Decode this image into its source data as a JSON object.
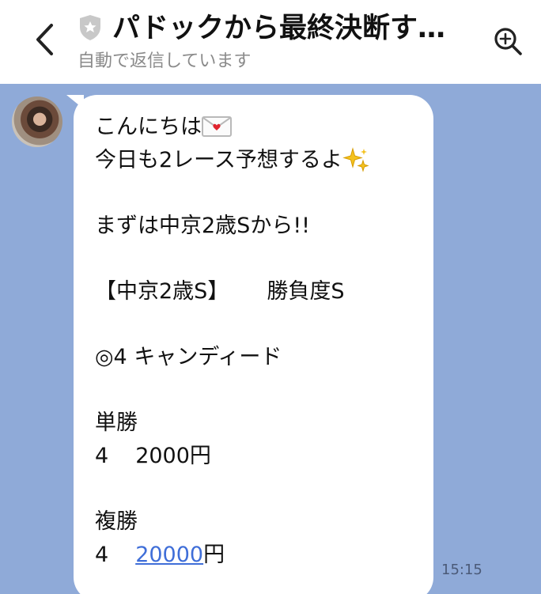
{
  "header": {
    "back_icon": "chevron-left-icon",
    "verified_icon": "shield-star-icon",
    "title": "パドックから最終決断す…",
    "subtitle": "自動で返信しています",
    "search_icon": "search-icon"
  },
  "message": {
    "line1": "こんにちは",
    "line1_emoji": "envelope-heart-emoji",
    "line2": "今日も2レース予想するよ",
    "line2_emoji": "sparkles-emoji",
    "line3": "まずは中京2歳Sから!!",
    "line4_a": "【中京2歳S】",
    "line4_b": "勝負度S",
    "line5": "◎4 キャンディード",
    "line6": "単勝",
    "line7_a": "4",
    "line7_b": "2000円",
    "line8": "複勝",
    "line9_a": "4",
    "line9_link": "20000",
    "line9_suffix": "円",
    "time": "15:15"
  },
  "colors": {
    "chat_background": "#8faad8",
    "bubble": "#ffffff",
    "link": "#3f6ed8"
  }
}
